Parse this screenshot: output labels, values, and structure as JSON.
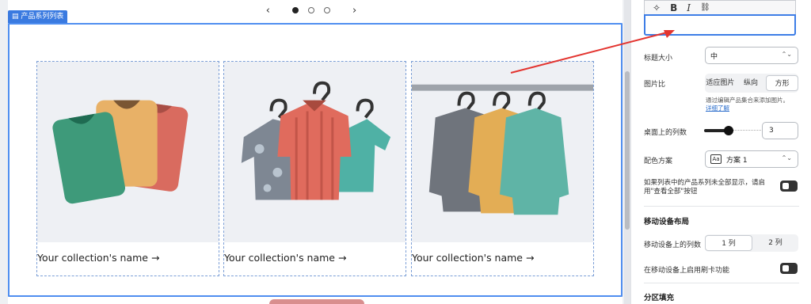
{
  "canvas": {
    "pager": {
      "prev": "‹",
      "next": "›",
      "dots": 3,
      "active_dot": 0
    },
    "section_tag": "▤ 产品系列列表",
    "cards": [
      {
        "caption": "Your collection's name →",
        "illustration": "folded-shirts"
      },
      {
        "caption": "Your collection's name →",
        "illustration": "hanging-shirts"
      },
      {
        "caption": "Your collection's name →",
        "illustration": "hanging-sweaters"
      }
    ]
  },
  "panel": {
    "toolbar": {
      "magic": "✧",
      "bold": "B",
      "italic": "I",
      "link": "🔗"
    },
    "title_value": "",
    "heading_size": {
      "label": "标题大小",
      "value": "中"
    },
    "image_ratio": {
      "label": "图片比",
      "options": [
        "适应图片",
        "纵向",
        "方形"
      ],
      "selected": 2,
      "help": "通过编辑产品集合来添加图片。",
      "help_link": "详细了解"
    },
    "desktop_columns": {
      "label": "桌面上的列数",
      "value": "3",
      "level": 0.33
    },
    "color_scheme": {
      "label": "配色方案",
      "badge": "Aa",
      "value": "方案 1"
    },
    "show_all": {
      "label": "如果列表中的产品系列未全部显示，请启用\"查看全部\"按钮"
    },
    "mobile_layout": {
      "heading": "移动设备布局",
      "columns_label": "移动设备上的列数",
      "options": [
        "1 列",
        "2 列"
      ],
      "selected": 0,
      "swipe_label": "在移动设备上启用刷卡功能"
    },
    "section_padding": {
      "heading": "分区填充"
    }
  },
  "colors": {
    "accent": "#3d7de6",
    "arrow": "#e3342f",
    "canvas_bg": "#eef0f3"
  }
}
